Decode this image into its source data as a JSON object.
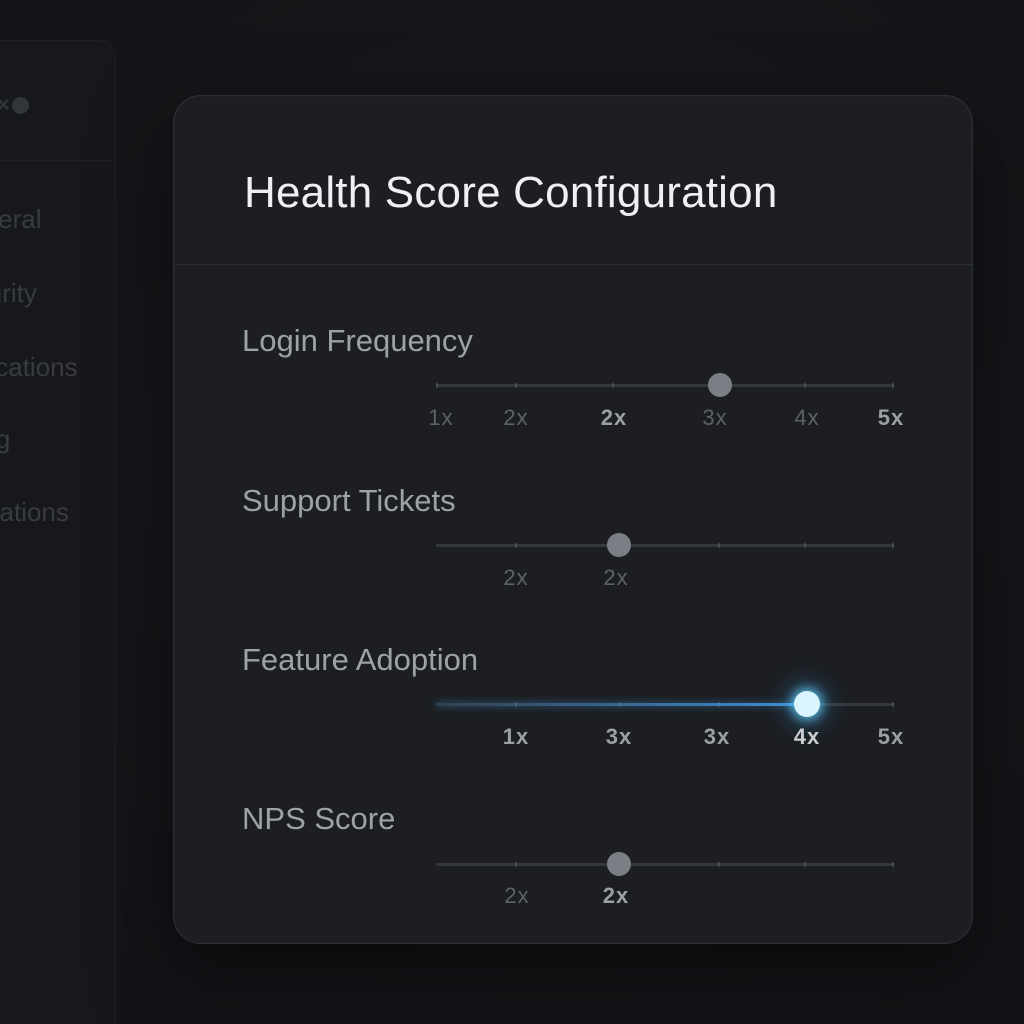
{
  "sidebar": {
    "items": [
      {
        "label": "General"
      },
      {
        "label": "Security"
      },
      {
        "label": "Notifications"
      },
      {
        "label": "Billing"
      },
      {
        "label": "Integrations"
      }
    ]
  },
  "modal": {
    "title": "Health Score Configuration"
  },
  "settings": [
    {
      "label": "Login Frequency",
      "value_fraction": 0.62,
      "active": false,
      "tick_labels": [
        "1x",
        "2x",
        "2x",
        "3x",
        "4x",
        "5x"
      ]
    },
    {
      "label": "Support Tickets",
      "value_fraction": 0.4,
      "active": false,
      "tick_labels": [
        "2x",
        "2x"
      ]
    },
    {
      "label": "Feature Adoption",
      "value_fraction": 0.81,
      "active": true,
      "tick_labels": [
        "1x",
        "3x",
        "3x",
        "4x",
        "5x"
      ]
    },
    {
      "label": "NPS Score",
      "value_fraction": 0.4,
      "active": false,
      "tick_labels": [
        "2x",
        "2x"
      ]
    }
  ],
  "colors": {
    "accent": "#3d8fd6",
    "thumb_active": "#d9f6ff",
    "thumb": "#7b7e84"
  }
}
